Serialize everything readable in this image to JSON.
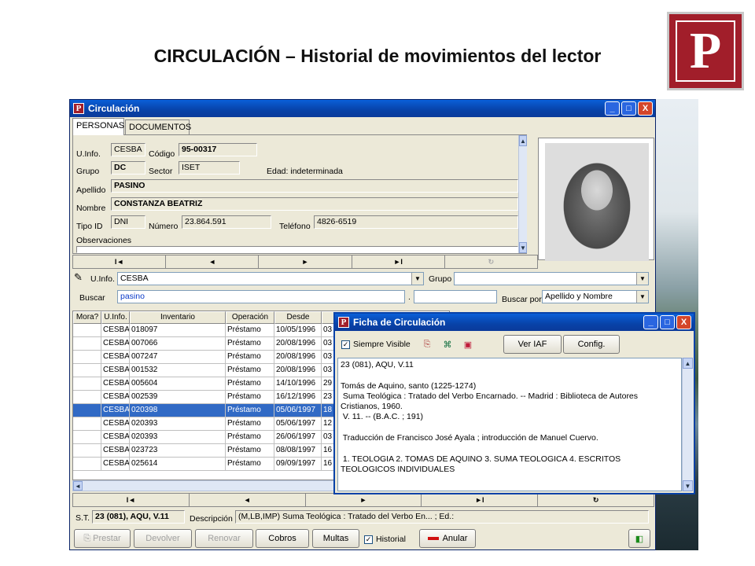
{
  "slide": {
    "title": "CIRCULACIÓN – Historial de movimientos del lector",
    "logo_letter": "P"
  },
  "window": {
    "title": "Circulación",
    "app_icon": "P",
    "min": "_",
    "max": "□",
    "close": "X"
  },
  "tabs": [
    {
      "label": "PERSONAS"
    },
    {
      "label": "DOCUMENTOS"
    }
  ],
  "person": {
    "uinfo_label": "U.Info.",
    "uinfo": "CESBA",
    "codigo_label": "Código",
    "codigo": "95-00317",
    "grupo_label": "Grupo",
    "grupo": "DC",
    "sector_label": "Sector",
    "sector": "ISET",
    "edad": "Edad: indeterminada",
    "apellido_label": "Apellido",
    "apellido": "PASINO",
    "nombre_label": "Nombre",
    "nombre": "CONSTANZA BEATRIZ",
    "tipoid_label": "Tipo ID",
    "tipoid": "DNI",
    "numero_label": "Número",
    "numero": "23.864.591",
    "telefono_label": "Teléfono",
    "telefono": "4826-6519",
    "observaciones_label": "Observaciones"
  },
  "nav": {
    "first": "I◄",
    "prev": "◄",
    "next": "►",
    "last": "►I",
    "refresh": "↻"
  },
  "filter": {
    "uinfo_label": "U.Info.",
    "uinfo": "CESBA",
    "grupo_label": "Grupo",
    "grupo": "",
    "buscar_label": "Buscar",
    "buscar": "pasino",
    "buscar2": "",
    "buscarpor_label": "Buscar por",
    "buscarpor": "Apellido y Nombre"
  },
  "grid": {
    "columns": [
      "Mora?",
      "U.Info.",
      "Inventario",
      "Operación",
      "Desde",
      ""
    ],
    "rows": [
      {
        "mora": "",
        "uinfo": "CESBA",
        "inventario": "018097",
        "operacion": "Préstamo",
        "desde": "10/05/1996",
        "extra": "03"
      },
      {
        "mora": "",
        "uinfo": "CESBA",
        "inventario": "007066",
        "operacion": "Préstamo",
        "desde": "20/08/1996",
        "extra": "03"
      },
      {
        "mora": "",
        "uinfo": "CESBA",
        "inventario": "007247",
        "operacion": "Préstamo",
        "desde": "20/08/1996",
        "extra": "03"
      },
      {
        "mora": "",
        "uinfo": "CESBA",
        "inventario": "001532",
        "operacion": "Préstamo",
        "desde": "20/08/1996",
        "extra": "03"
      },
      {
        "mora": "",
        "uinfo": "CESBA",
        "inventario": "005604",
        "operacion": "Préstamo",
        "desde": "14/10/1996",
        "extra": "29"
      },
      {
        "mora": "",
        "uinfo": "CESBA",
        "inventario": "002539",
        "operacion": "Préstamo",
        "desde": "16/12/1996",
        "extra": "23"
      },
      {
        "mora": "",
        "uinfo": "CESBA",
        "inventario": "020398",
        "operacion": "Préstamo",
        "desde": "05/06/1997",
        "extra": "18",
        "selected": true
      },
      {
        "mora": "",
        "uinfo": "CESBA",
        "inventario": "020393",
        "operacion": "Préstamo",
        "desde": "05/06/1997",
        "extra": "12"
      },
      {
        "mora": "",
        "uinfo": "CESBA",
        "inventario": "020393",
        "operacion": "Préstamo",
        "desde": "26/06/1997",
        "extra": "03"
      },
      {
        "mora": "",
        "uinfo": "CESBA",
        "inventario": "023723",
        "operacion": "Préstamo",
        "desde": "08/08/1997",
        "extra": "16"
      },
      {
        "mora": "",
        "uinfo": "CESBA",
        "inventario": "025614",
        "operacion": "Préstamo",
        "desde": "09/09/1997",
        "extra": "16"
      }
    ]
  },
  "footer": {
    "st_label": "S.T.",
    "st": "23 (081), AQU, V.11",
    "descripcion_label": "Descripción",
    "descripcion": "(M,LB,IMP) Suma Teológica : Tratado del Verbo En... ; Ed.:",
    "buttons": {
      "prestar": "Prestar",
      "devolver": "Devolver",
      "renovar": "Renovar",
      "cobros": "Cobros",
      "multas": "Multas",
      "historial": "Historial",
      "anular": "Anular"
    }
  },
  "ficha": {
    "title": "Ficha de Circulación",
    "siempre_visible": "Siempre Visible",
    "ver_iaf": "Ver IAF",
    "config": "Config.",
    "text": "23 (081), AQU, V.11\n\nTomás de Aquino, santo (1225-1274)\n Suma Teológica : Tratado del Verbo Encarnado. -- Madrid : Biblioteca de Autores\nCristianos, 1960.\n V. 11. -- (B.A.C. ; 191)\n\n Traducción de Francisco José Ayala ; introducción de Manuel Cuervo.\n\n 1. TEOLOGIA 2. TOMAS DE AQUINO 3. SUMA TEOLOGICA 4. ESCRITOS\nTEOLOGICOS INDIVIDUALES"
  },
  "colors": {
    "accent": "#0842a8",
    "brand": "#a11e2a",
    "selection": "#316ac5"
  }
}
